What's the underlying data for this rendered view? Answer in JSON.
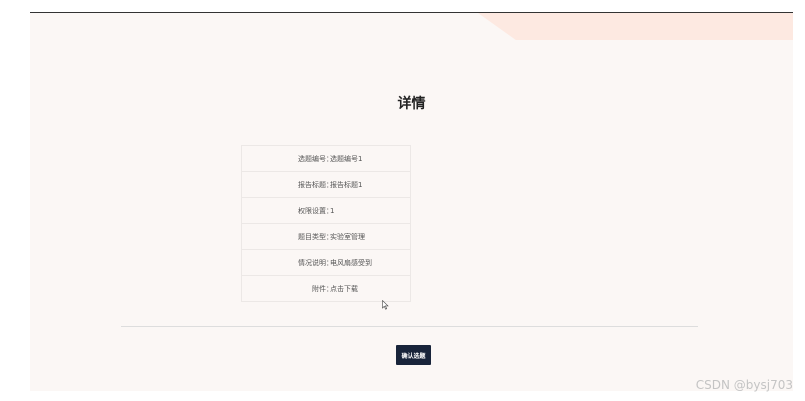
{
  "page": {
    "title": "详情"
  },
  "details": [
    {
      "label": "选题编号",
      "value": "选题编号1"
    },
    {
      "label": "报告标题",
      "value": "报告标题1"
    },
    {
      "label": "权限设置",
      "value": "1"
    },
    {
      "label": "题目类型",
      "value": "实验室管理"
    },
    {
      "label": "情况说明",
      "value": "电风扇感受到"
    },
    {
      "label": "附件",
      "value": "点击下载"
    }
  ],
  "separator": "：",
  "actions": {
    "confirm_label": "确认选题"
  },
  "watermark": "CSDN @bysj703",
  "colors": {
    "panel_background": "#fbf7f5",
    "accent": "#fde9e1",
    "button_background": "#18243a"
  }
}
